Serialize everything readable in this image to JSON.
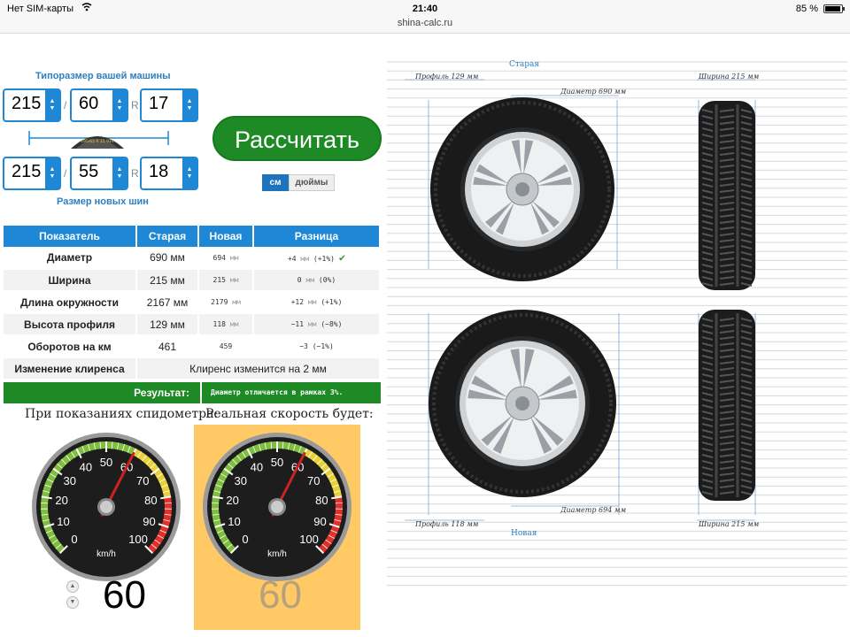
{
  "status": {
    "carrier": "Нет SIM-карты",
    "time": "21:40",
    "url": "shina-calc.ru",
    "battery": "85 %",
    "battery_level": 0.85
  },
  "form": {
    "old_title": "Типоразмер вашей машины",
    "new_title": "Размер новых шин",
    "old": {
      "width": "215",
      "profile": "60",
      "rim": "17"
    },
    "new": {
      "width": "215",
      "profile": "55",
      "rim": "18"
    },
    "separator": "/",
    "rim_prefix": "R",
    "tire_mark": "195/65 R 15 91V"
  },
  "calculate_label": "Рассчитать",
  "units": {
    "cm": "см",
    "inch": "дюймы"
  },
  "table": {
    "headers": [
      "Показатель",
      "Старая",
      "Новая",
      "Разница"
    ],
    "rows": [
      {
        "param": "Диаметр",
        "old": "690 мм",
        "new_val": "694",
        "new_unit": "мм",
        "diff": "+4",
        "diff_unit": "мм",
        "diff_pct": "(+1%)",
        "ok": "✔"
      },
      {
        "param": "Ширина",
        "old": "215 мм",
        "new_val": "215",
        "new_unit": "мм",
        "diff": "0",
        "diff_unit": "мм",
        "diff_pct": "(0%)"
      },
      {
        "param": "Длина окружности",
        "old": "2167 мм",
        "new_val": "2179",
        "new_unit": "мм",
        "diff": "+12",
        "diff_unit": "мм",
        "diff_pct": "(+1%)"
      },
      {
        "param": "Высота профиля",
        "old": "129 мм",
        "new_val": "118",
        "new_unit": "мм",
        "diff": "−11",
        "diff_unit": "мм",
        "diff_pct": "(−8%)"
      },
      {
        "param": "Оборотов на км",
        "old": "461",
        "new_val": "459",
        "new_unit": "",
        "diff": "−3",
        "diff_unit": "",
        "diff_pct": "(−1%)"
      }
    ],
    "clearance_label": "Изменение клиренса",
    "clearance_value": "Клиренс изменится на 2 мм",
    "result_label": "Результат:",
    "result_value": "Диаметр отличается в рамках 3%."
  },
  "speed": {
    "caption_left": "При показаниях спидометра:",
    "caption_right": "Реальная скорость будет:",
    "unit": "km/h",
    "ticks": [
      "0",
      "10",
      "20",
      "30",
      "40",
      "50",
      "60",
      "70",
      "80",
      "90",
      "100"
    ],
    "indicated": "60",
    "real": "60",
    "needle_value": 60
  },
  "diagram": {
    "old_title": "Старая",
    "new_title": "Новая",
    "old_profile": "Профиль 129 мм",
    "old_width": "Ширина 215 мм",
    "old_diameter": "Диаметр 690 мм",
    "new_profile": "Профиль 118 мм",
    "new_width": "Ширина 215 мм",
    "new_diameter": "Диаметр 694 мм"
  },
  "colors": {
    "accent": "#1e88d6",
    "green": "#1d8a26",
    "gauge_panel": "#ffca66",
    "needle": "#cc2222"
  }
}
